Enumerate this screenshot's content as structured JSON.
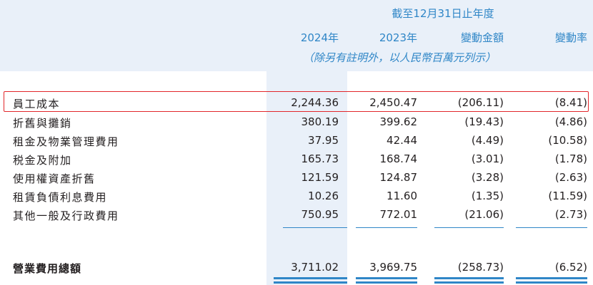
{
  "header": {
    "period": "截至12月31日止年度",
    "columns": [
      "2024年",
      "2023年",
      "變動金額",
      "變動率"
    ],
    "note": "（除另有註明外，以人民幣百萬元列示）"
  },
  "rows": [
    {
      "label": "員工成本",
      "values": [
        "2,244.36",
        "2,450.47",
        "(206.11)",
        "(8.41)"
      ]
    },
    {
      "label": "折舊與攤銷",
      "values": [
        "380.19",
        "399.62",
        "(19.43)",
        "(4.86)"
      ]
    },
    {
      "label": "租金及物業管理費用",
      "values": [
        "37.95",
        "42.44",
        "(4.49)",
        "(10.58)"
      ]
    },
    {
      "label": "税金及附加",
      "values": [
        "165.73",
        "168.74",
        "(3.01)",
        "(1.78)"
      ]
    },
    {
      "label": "使用權資產折舊",
      "values": [
        "121.59",
        "124.87",
        "(3.28)",
        "(2.63)"
      ]
    },
    {
      "label": "租賃負債利息費用",
      "values": [
        "10.26",
        "11.60",
        "(1.35)",
        "(11.59)"
      ]
    },
    {
      "label": "其他一般及行政費用",
      "values": [
        "750.95",
        "772.01",
        "(21.06)",
        "(2.73)"
      ]
    }
  ],
  "total": {
    "label": "營業費用總額",
    "values": [
      "3,711.02",
      "3,969.75",
      "(258.73)",
      "(6.52)"
    ]
  }
}
